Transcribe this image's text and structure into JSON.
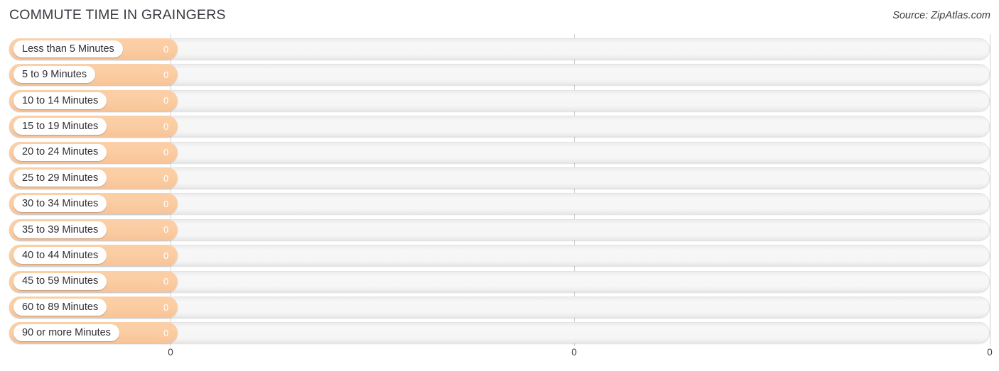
{
  "header": {
    "title": "COMMUTE TIME IN GRAINGERS",
    "source": "Source: ZipAtlas.com"
  },
  "colors": {
    "bar_fill": "#fbcda3",
    "track": "#f6f6f6",
    "gridline": "#cfcfcf",
    "label_text": "#2f2f35",
    "value_text": "#ffffff"
  },
  "chart_data": {
    "type": "bar",
    "orientation": "horizontal",
    "title": "COMMUTE TIME IN GRAINGERS",
    "xlabel": "",
    "ylabel": "",
    "grid": true,
    "legend": false,
    "xlim": [
      0,
      0
    ],
    "xticks": [
      "0",
      "0",
      "0"
    ],
    "xtick_values": [
      0,
      0,
      0
    ],
    "categories": [
      "Less than 5 Minutes",
      "5 to 9 Minutes",
      "10 to 14 Minutes",
      "15 to 19 Minutes",
      "20 to 24 Minutes",
      "25 to 29 Minutes",
      "30 to 34 Minutes",
      "35 to 39 Minutes",
      "40 to 44 Minutes",
      "45 to 59 Minutes",
      "60 to 89 Minutes",
      "90 or more Minutes"
    ],
    "values": [
      0,
      0,
      0,
      0,
      0,
      0,
      0,
      0,
      0,
      0,
      0,
      0
    ],
    "value_labels": [
      "0",
      "0",
      "0",
      "0",
      "0",
      "0",
      "0",
      "0",
      "0",
      "0",
      "0",
      "0"
    ]
  }
}
